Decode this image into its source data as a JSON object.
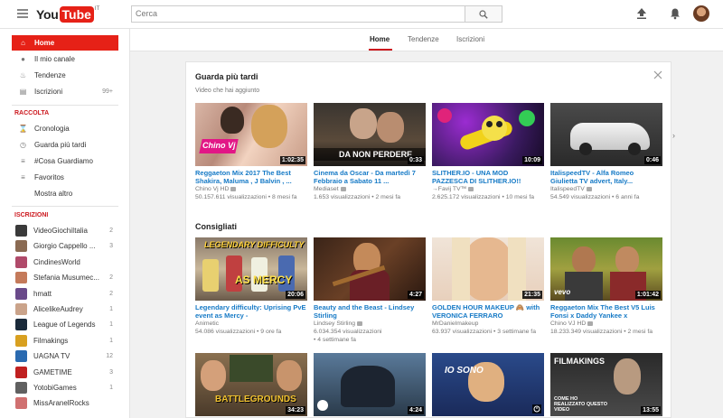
{
  "topbar": {
    "logo_you": "You",
    "logo_tube": "Tube",
    "logo_country": "IT",
    "search_placeholder": "Cerca"
  },
  "subnav": {
    "tabs": [
      "Home",
      "Tendenze",
      "Iscrizioni"
    ]
  },
  "sidebar": {
    "main": [
      {
        "label": "Home",
        "icon": "home-icon"
      },
      {
        "label": "Il mio canale",
        "icon": "person-icon"
      },
      {
        "label": "Tendenze",
        "icon": "flame-icon"
      },
      {
        "label": "Iscrizioni",
        "icon": "subscriptions-icon",
        "count": "99+"
      }
    ],
    "library_heading": "RACCOLTA",
    "library": [
      {
        "label": "Cronologia",
        "icon": "history-icon"
      },
      {
        "label": "Guarda più tardi",
        "icon": "clock-icon"
      },
      {
        "label": "#Cosa Guardiamo",
        "icon": "playlist-icon"
      },
      {
        "label": "Favoritos",
        "icon": "playlist-icon"
      }
    ],
    "more_label": "Mostra altro",
    "subs_heading": "ISCRIZIONI",
    "subscriptions": [
      {
        "label": "VideoGiochiItalia",
        "count": "2",
        "color": "#3a3a3a"
      },
      {
        "label": "Giorgio Cappello ...",
        "count": "3",
        "color": "#8a6a52"
      },
      {
        "label": "CindinesWorld",
        "count": "",
        "color": "#b04a6a"
      },
      {
        "label": "Stefania Musumec...",
        "count": "2",
        "color": "#c47a5a"
      },
      {
        "label": "hmatt",
        "count": "2",
        "color": "#6a4a8a"
      },
      {
        "label": "AlicelikeAudrey",
        "count": "1",
        "color": "#caa38a"
      },
      {
        "label": "League of Legends",
        "count": "1",
        "color": "#1a2a3a"
      },
      {
        "label": "Filmakings",
        "count": "1",
        "color": "#d8a020"
      },
      {
        "label": "UAGNA TV",
        "count": "12",
        "color": "#2a6ab0"
      },
      {
        "label": "GAMETIME",
        "count": "3",
        "color": "#c02020"
      },
      {
        "label": "YotobiGames",
        "count": "1",
        "color": "#606060"
      },
      {
        "label": "MissAranelRocks",
        "count": "",
        "color": "#d07070"
      }
    ]
  },
  "watch_later": {
    "title": "Guarda più tardi",
    "subtitle": "Video che hai aggiunto",
    "videos": [
      {
        "title": "Reggaeton Mix 2017 The Best Shakira, Maluma , J Balvin , ...",
        "channel": "Chino Vj HD",
        "meta": "50.157.611 visualizzazioni • 8 mesi fa",
        "duration": "1:02:35",
        "overlay": "Chino Vj"
      },
      {
        "title": "Cinema da Oscar - Da martedì 7 Febbraio a Sabato 11 ...",
        "channel": "Mediaset",
        "meta": "1.653 visualizzazioni • 2 mesi fa",
        "duration": "0:33",
        "overlay": "DA NON PERDERE"
      },
      {
        "title": "SLITHER.IO - UNA MOD PAZZESCA DI SLITHER.IO!!",
        "channel": "→Favij TV™",
        "meta": "2.625.172 visualizzazioni • 10 mesi fa",
        "duration": "10:09",
        "overlay": ""
      },
      {
        "title": "ItalispeedTV - Alfa Romeo Giulietta TV advert, Italy...",
        "channel": "ItalispeedTV",
        "meta": "54.549 visualizzazioni • 6 anni fa",
        "duration": "0:46",
        "overlay": ""
      }
    ]
  },
  "recommended": {
    "title": "Consigliati",
    "videos": [
      {
        "title": "Legendary difficulty: Uprising PvE event as Mercy -",
        "channel": "Animetic",
        "meta": "54.086 visualizzazioni • 9 ore fa",
        "duration": "20:06",
        "overlay": "LEGENDARY DIFFICULTY"
      },
      {
        "title": "Beauty and the Beast - Lindsey Stirling",
        "channel": "Lindsey Stirling",
        "meta": "6.034.354 visualizzazioni",
        "meta2": "• 4 settimane fa",
        "duration": "4:27",
        "overlay": ""
      },
      {
        "title": "GOLDEN HOUR MAKEUP 🙈 with VERONICA FERRARO",
        "channel": "MrDanielmakeup",
        "meta": "63.937 visualizzazioni • 3 settimane fa",
        "duration": "21:35",
        "overlay": ""
      },
      {
        "title": "Reggaeton Mix The Best V5 Luis Fonsi x Daddy Yankee x",
        "channel": "Chino VJ HD",
        "meta": "18.233.349 visualizzazioni • 2 mesi fa",
        "duration": "1:01:42",
        "overlay": "vevo"
      }
    ],
    "row3": [
      {
        "duration": "34:23",
        "overlay": "BATTLEGROUNDS"
      },
      {
        "duration": "4:24",
        "overlay": ""
      },
      {
        "duration": "",
        "overlay": "IO SONO"
      },
      {
        "duration": "13:55",
        "overlay": "FILMAKINGS"
      }
    ],
    "row3_caption": "COME HO REALIZZATO QUESTO VIDEO"
  }
}
